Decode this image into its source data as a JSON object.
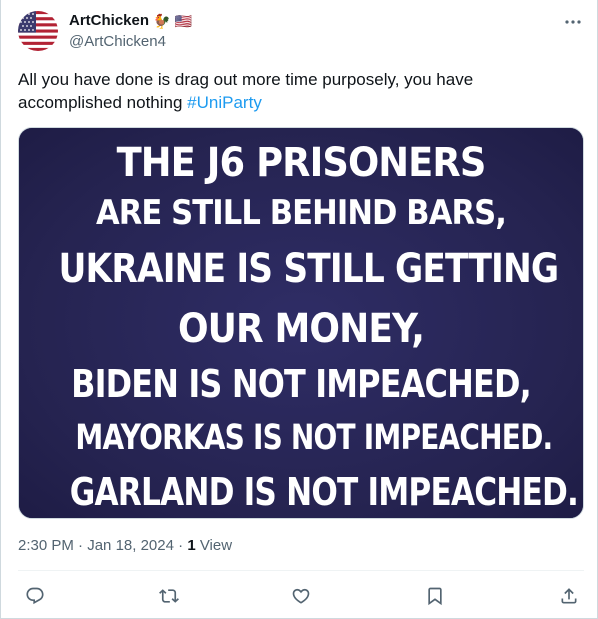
{
  "author": {
    "display_name": "ArtChicken",
    "name_emojis": [
      "🐓",
      "🇺🇸"
    ],
    "handle": "@ArtChicken4",
    "avatar_icon": "us-flag-avatar"
  },
  "tweet": {
    "text": "All you have done is drag out more time purposely,  you have accomplished nothing ",
    "hashtag": "#UniParty",
    "hashtag_color": "#1d9bf0"
  },
  "media": {
    "lines": [
      "THE J6 PRISONERS",
      "ARE STILL BEHIND BARS,",
      "UKRAINE IS STILL GETTING",
      "OUR MONEY,",
      "BIDEN IS NOT IMPEACHED,",
      "MAYORKAS IS NOT IMPEACHED.",
      "GARLAND IS NOT IMPEACHED."
    ],
    "background_color": "#2a2856"
  },
  "meta": {
    "time": "2:30 PM",
    "separator": "·",
    "date": "Jan 18, 2024",
    "views_count": "1",
    "views_label": " View"
  },
  "actions": [
    {
      "icon": "reply-icon"
    },
    {
      "icon": "retweet-icon"
    },
    {
      "icon": "like-icon"
    },
    {
      "icon": "bookmark-icon"
    },
    {
      "icon": "share-icon"
    }
  ],
  "colors": {
    "text_primary": "#0f1419",
    "text_secondary": "#536471",
    "border": "#cfd9de"
  }
}
